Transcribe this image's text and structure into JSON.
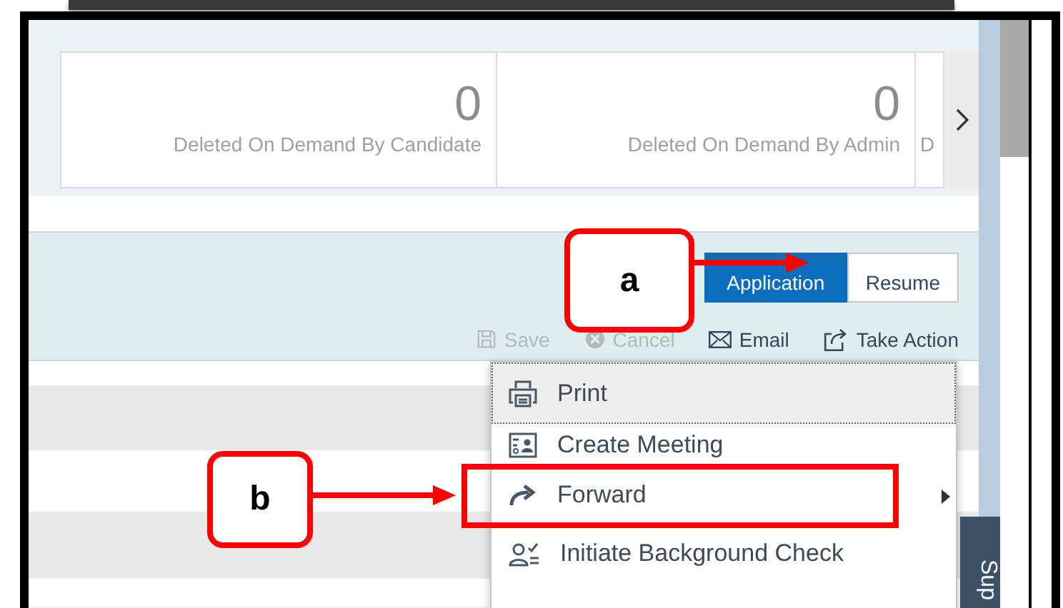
{
  "tiles": [
    {
      "count": "0",
      "label": "Deleted On Demand By Candidate"
    },
    {
      "count": "0",
      "label": "Deleted On Demand By Admin"
    },
    {
      "label": "D"
    }
  ],
  "view_toggle": [
    {
      "label": "Application",
      "selected": true
    },
    {
      "label": "Resume",
      "selected": false
    }
  ],
  "actions": [
    {
      "label": "Save",
      "kind": "save",
      "disabled": true
    },
    {
      "label": "Cancel",
      "kind": "cancel",
      "disabled": true
    },
    {
      "label": "Email",
      "kind": "email",
      "disabled": false
    },
    {
      "label": "Take Action",
      "kind": "take-action",
      "disabled": false
    }
  ],
  "menu": {
    "items": [
      {
        "label": "Print",
        "kind": "print",
        "selected": true,
        "submenu": false
      },
      {
        "label": "Create Meeting",
        "kind": "meeting",
        "selected": false,
        "submenu": false
      },
      {
        "label": "Forward",
        "kind": "forward",
        "selected": false,
        "submenu": true
      },
      {
        "label": "Initiate Background Check",
        "kind": "background-check",
        "selected": false,
        "submenu": false
      }
    ]
  },
  "side_tab": {
    "label": "Sup"
  },
  "annotations": {
    "callouts": [
      {
        "label": "a"
      },
      {
        "label": "b"
      }
    ]
  }
}
